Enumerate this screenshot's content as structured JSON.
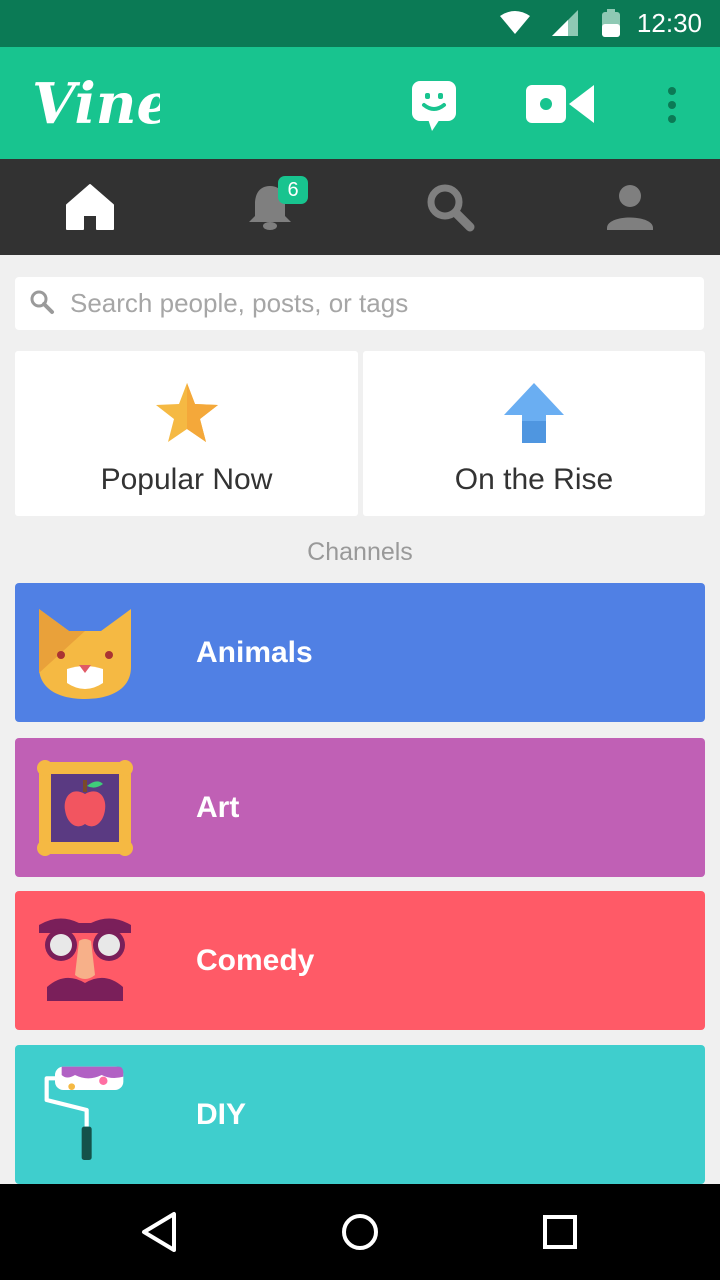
{
  "status_bar": {
    "time": "12:30",
    "icons": [
      "wifi-icon",
      "signal-icon",
      "battery-icon"
    ]
  },
  "app_bar": {
    "logo_text": "Vine",
    "actions": [
      "chat-icon",
      "video-camera-icon",
      "overflow-menu-icon"
    ],
    "color": "#18c48f"
  },
  "tabs": [
    {
      "name": "home",
      "icon": "home-icon",
      "active": true
    },
    {
      "name": "notifications",
      "icon": "bell-icon",
      "badge": "6"
    },
    {
      "name": "search",
      "icon": "search-icon"
    },
    {
      "name": "profile",
      "icon": "person-icon"
    }
  ],
  "search": {
    "placeholder": "Search people, posts, or tags"
  },
  "featured": [
    {
      "label": "Popular Now",
      "icon": "star-icon"
    },
    {
      "label": "On the Rise",
      "icon": "arrow-up-icon"
    }
  ],
  "channels_heading": "Channels",
  "channels": [
    {
      "name": "Animals",
      "color": "#5080e4",
      "icon": "cat-icon"
    },
    {
      "name": "Art",
      "color": "#c060b5",
      "icon": "framed-apple-icon"
    },
    {
      "name": "Comedy",
      "color": "#ff5a67",
      "icon": "disguise-glasses-icon"
    },
    {
      "name": "DIY",
      "color": "#3fcecd",
      "icon": "paint-roller-icon"
    }
  ],
  "nav_bar": {
    "buttons": [
      "back-icon",
      "home-circle-icon",
      "recents-icon"
    ]
  }
}
